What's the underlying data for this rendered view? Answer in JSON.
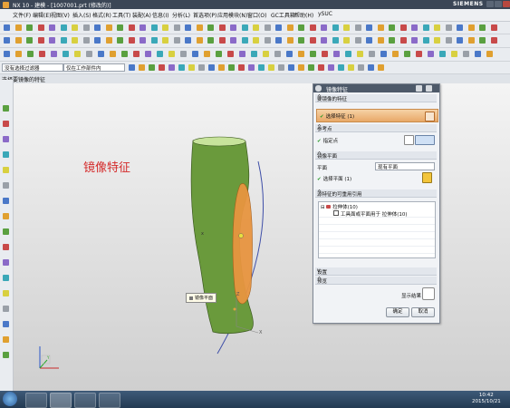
{
  "window": {
    "title": "NX 10 - 建模 - [1007001.prt (修改的)]",
    "brand": "SIEMENS"
  },
  "menu": [
    "文件(F)",
    "编辑(E)",
    "视图(V)",
    "插入(S)",
    "格式(R)",
    "工具(T)",
    "装配(A)",
    "信息(I)",
    "分析(L)",
    "首选项(P)",
    "应用模块(N)",
    "窗口(O)",
    "GC工具箱",
    "帮助(H)",
    "ySUC"
  ],
  "selection_bar": {
    "filter": "没有选择过滤器",
    "scope": "仅在工作部件内"
  },
  "prompt": "选择要镜像的特征",
  "viewport": {
    "label": "镜像特征",
    "tooltip": "镜像平面",
    "axis_z": "Z",
    "axis_x": "X",
    "axis_y": "Y"
  },
  "dialog": {
    "title": "镜像特征",
    "sections": {
      "features": "要镜像的特征",
      "reference": "参考点",
      "mirror_plane": "镜像平面",
      "related": "源特征的可重用引用",
      "settings": "设置",
      "preview": "预览"
    },
    "select_feature": "选择特征 (1)",
    "point_label": "指定点",
    "plane_label": "平面",
    "plane_value": "现有平面",
    "select_plane": "选择平面 (1)",
    "list_items": [
      "拉伸体(10)",
      "工具面或平面用于 拉伸体(10)"
    ],
    "show_result": "显示结果",
    "ok": "确定",
    "cancel": "取消"
  },
  "taskbar": {
    "time": "10:42",
    "date": "2015/10/21"
  }
}
